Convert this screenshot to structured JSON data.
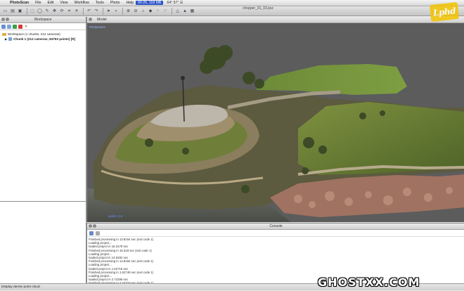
{
  "menubar": {
    "app_name": "PhotoScan",
    "items": [
      "File",
      "Edit",
      "View",
      "Workflow",
      "Tools",
      "Photo",
      "Help"
    ],
    "recording": "00:26, 118 MB",
    "tray": "64° 57°  ☰"
  },
  "document_title": "chopper_01_03.psz",
  "watermark_top": "Lphd",
  "workspace": {
    "title": "Workspace",
    "root": "Workspace (1 chunks, 212 cameras)",
    "chunk": "Chunk 1 (212 cameras, 84753 points) [R]"
  },
  "model": {
    "title": "Model",
    "view_label": "Perspective",
    "scale_label": "points: 2.5"
  },
  "console": {
    "title": "Console",
    "lines": [
      "Finished processing in 13.8164 sec (exit code 1)",
      "Loading project...",
      "loaded project in 16.3178 sec",
      "Finished processing in 16.318 sec (exit code 1)",
      "Loading project...",
      "loaded project in 14.8182 sec",
      "Finished processing in 14.8184 sec (exit code 1)",
      "Loading project...",
      "loaded project in 1.52718 sec",
      "Finished processing in 1.52749 sec (exit code 1)",
      "Loading project...",
      "loaded project in 2.74296 sec",
      "Finished processing in 2.74323 sec (exit code 1)"
    ]
  },
  "statusbar": {
    "text": "Display dense point cloud"
  },
  "watermark_bottom": "GHOSTXX.COM",
  "toolbar_icons": [
    "new-icon",
    "open-icon",
    "save-icon",
    "sep",
    "rect-select-icon",
    "circle-select-icon",
    "free-select-icon",
    "move-icon",
    "rotate-icon",
    "crop-icon",
    "delete-icon",
    "sep",
    "undo-icon",
    "redo-icon",
    "sep",
    "navigation-icon",
    "camera-icon",
    "sep",
    "zoom-in-icon",
    "zoom-out-icon",
    "reset-view-icon",
    "show-cameras-icon",
    "point-cloud-icon",
    "dense-cloud-icon",
    "sep",
    "wireframe-icon",
    "shaded-icon",
    "textured-icon"
  ]
}
